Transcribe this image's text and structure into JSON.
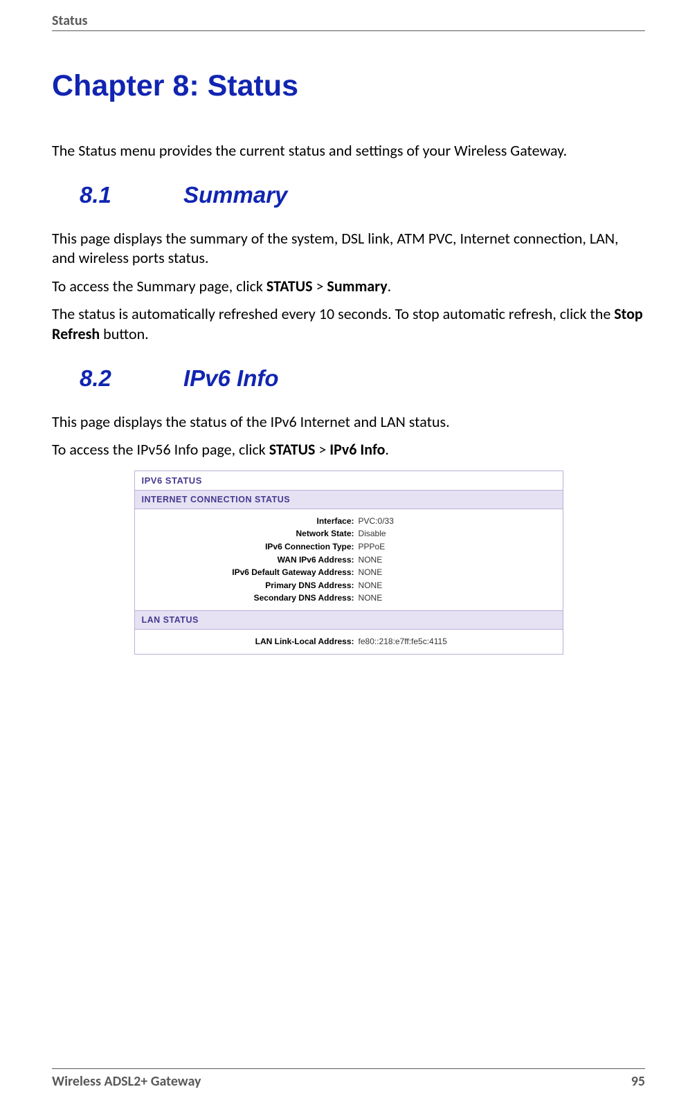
{
  "header": {
    "section": "Status"
  },
  "chapter": {
    "title": "Chapter 8:  Status"
  },
  "intro": "The Status menu provides the current status and settings of your Wireless Gateway.",
  "sections": {
    "s81": {
      "num": "8.1",
      "title": "Summary",
      "p1": "This page displays the summary of the system, DSL link, ATM PVC, Internet connection, LAN, and wireless ports status.",
      "p2_pre": "To access the Summary page, click ",
      "p2_b1": "STATUS",
      "p2_mid": " > ",
      "p2_b2": "Summary",
      "p2_post": ".",
      "p3_pre": "The status is automatically refreshed every 10 seconds. To stop automatic refresh, click the ",
      "p3_b1": "Stop Refresh",
      "p3_post": " button."
    },
    "s82": {
      "num": "8.2",
      "title": "IPv6 Info",
      "p1": "This page displays the status of the IPv6 Internet and LAN status.",
      "p2_pre": "To access the IPv56 Info page, click ",
      "p2_b1": "STATUS",
      "p2_mid": " > ",
      "p2_b2": "IPv6 Info",
      "p2_post": "."
    }
  },
  "panel": {
    "title": "IPV6 STATUS",
    "sub1": "INTERNET CONNECTION STATUS",
    "rows1": [
      {
        "label": "Interface:",
        "value": "PVC:0/33"
      },
      {
        "label": "Network State:",
        "value": "Disable"
      },
      {
        "label": "IPv6 Connection Type:",
        "value": "PPPoE"
      },
      {
        "label": "WAN IPv6 Address:",
        "value": "NONE"
      },
      {
        "label": "IPv6 Default Gateway Address:",
        "value": "NONE"
      },
      {
        "label": "Primary DNS Address:",
        "value": "NONE"
      },
      {
        "label": "Secondary DNS Address:",
        "value": "NONE"
      }
    ],
    "sub2": "LAN STATUS",
    "rows2": [
      {
        "label": "LAN Link-Local Address:",
        "value": "fe80::218:e7ff:fe5c:4115"
      }
    ]
  },
  "footer": {
    "product": "Wireless ADSL2+ Gateway",
    "page": "95"
  }
}
